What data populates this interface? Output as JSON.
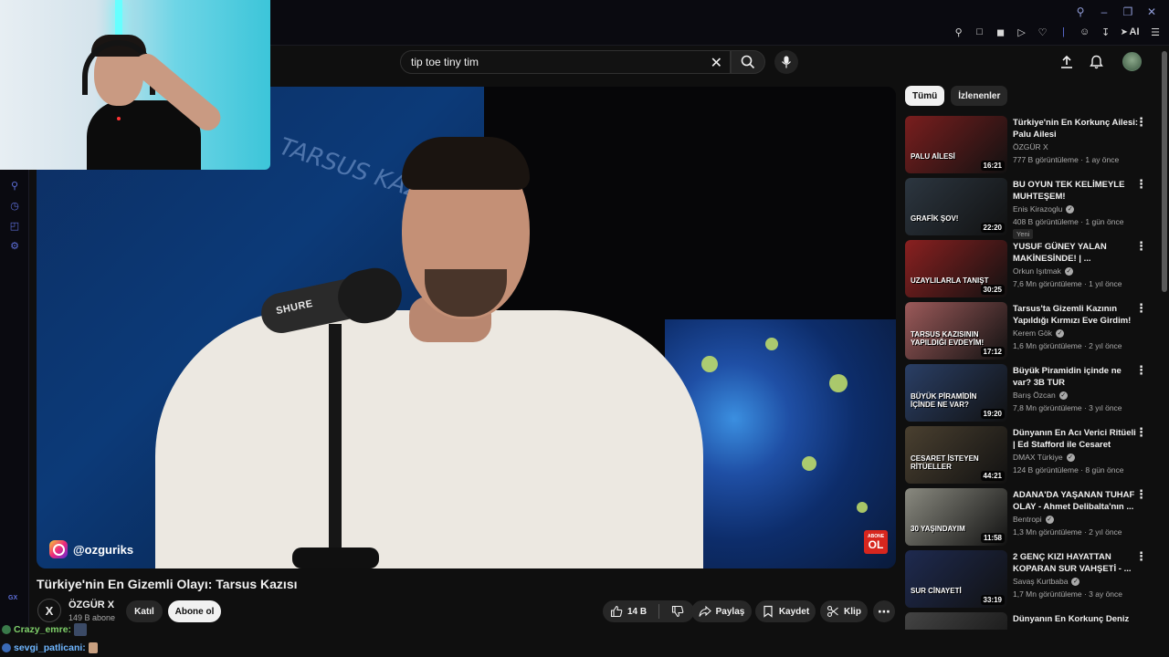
{
  "browser": {
    "gx_label": "GX",
    "toolbar_ai_label": "AI"
  },
  "search": {
    "query": "tip toe tiny tim"
  },
  "video": {
    "title": "Türkiye'nin En Gizemli Olayı: Tarsus Kazısı",
    "watermark_handle": "@ozguriks",
    "abone_badge_line1": "ABONE",
    "abone_badge_line2": "OL",
    "mic_brand": "SHURE",
    "chalk_text": "TARSUS KAZISI"
  },
  "channel": {
    "avatar_letter": "X",
    "name": "ÖZGÜR X",
    "subscribers": "149 B abone",
    "join_label": "Katıl",
    "subscribe_label": "Abone ol"
  },
  "actions": {
    "like_count": "14 B",
    "share_label": "Paylaş",
    "save_label": "Kaydet",
    "clip_label": "Klip"
  },
  "sidebar": {
    "filters": [
      "Tümü",
      "İzlenenler"
    ],
    "items": [
      {
        "title": "Türkiye'nin En Korkunç Ailesi: Palu Ailesi",
        "channel": "ÖZGÜR X",
        "verified": false,
        "meta": "777 B görüntüleme · 1 ay önce",
        "duration": "16:21",
        "badge": "",
        "thumb_text": "PALU AİLESİ",
        "thumb_color": "#7a1e1e"
      },
      {
        "title": "BU OYUN TEK KELİMEYLE MUHTEŞEM!",
        "channel": "Enis Kirazoglu",
        "verified": true,
        "meta": "408 B görüntüleme · 1 gün önce",
        "duration": "22:20",
        "badge": "Yeni",
        "thumb_text": "GRAFİK ŞOV!",
        "thumb_color": "#2c3640"
      },
      {
        "title": "YUSUF GÜNEY YALAN MAKİNESİNDE! | ...",
        "channel": "Orkun Işıtmak",
        "verified": true,
        "meta": "7,6 Mn görüntüleme · 1 yıl önce",
        "duration": "30:25",
        "badge": "",
        "thumb_text": "UZAYLILARLA TANIŞT",
        "thumb_color": "#8a2020"
      },
      {
        "title": "Tarsus'ta Gizemli Kazının Yapıldığı Kırmızı Eve Girdim!",
        "channel": "Kerem Gök",
        "verified": true,
        "meta": "1,6 Mn görüntüleme · 2 yıl önce",
        "duration": "17:12",
        "badge": "",
        "thumb_text": "TARSUS KAZISININ YAPILDIĞI EVDEYİM!",
        "thumb_color": "#9c5a5a"
      },
      {
        "title": "Büyük Piramidin içinde ne var? 3B TUR",
        "channel": "Barış Özcan",
        "verified": true,
        "meta": "7,8 Mn görüntüleme · 3 yıl önce",
        "duration": "19:20",
        "badge": "",
        "thumb_text": "BÜYÜK PİRAMİDİN İÇİNDE NE VAR?",
        "thumb_color": "#2a3f66"
      },
      {
        "title": "Dünyanın En Acı Verici Ritüeli | Ed Stafford ile Cesaret İsteyen...",
        "channel": "DMAX Türkiye",
        "verified": true,
        "meta": "124 B görüntüleme · 8 gün önce",
        "duration": "44:21",
        "badge": "",
        "thumb_text": "CESARET İSTEYEN RİTÜELLER",
        "thumb_color": "#4a4030"
      },
      {
        "title": "ADANA'DA YAŞANAN TUHAF OLAY - Ahmet Delibalta'nın ...",
        "channel": "Bentropi",
        "verified": true,
        "meta": "1,3 Mn görüntüleme · 2 yıl önce",
        "duration": "11:58",
        "badge": "",
        "thumb_text": "30 YAŞINDAYIM",
        "thumb_color": "#8a8a80"
      },
      {
        "title": "2 GENÇ KIZI HAYATTAN KOPARAN SUR VAHŞETİ - ...",
        "channel": "Savaş Kurtbaba",
        "verified": true,
        "meta": "1,7 Mn görüntüleme · 3 ay önce",
        "duration": "33:19",
        "badge": "",
        "thumb_text": "SUR CİNAYETİ",
        "thumb_color": "#1e2a50"
      },
      {
        "title": "Dünyanın En Korkunç Deniz",
        "channel": "",
        "verified": false,
        "meta": "",
        "duration": "",
        "badge": "",
        "thumb_text": "",
        "thumb_color": "#444"
      }
    ]
  },
  "chat": [
    {
      "user": "Crazy_emre:",
      "color": "#7fd06a"
    },
    {
      "user": "sevgi_patlicani:",
      "color": "#6fb6ff"
    }
  ],
  "colors": {
    "accent_blue": "#5d6ed8",
    "subscribe_bg": "#f1f1f1",
    "abone_red": "#d7261e"
  }
}
